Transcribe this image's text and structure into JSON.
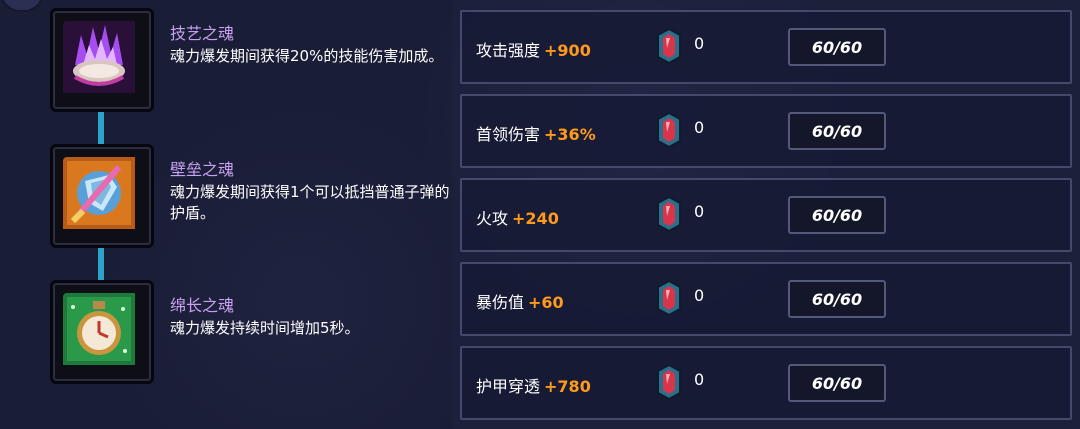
{
  "skills": [
    {
      "name": "技艺之魂",
      "description": "魂力爆发期间获得20%的技能伤害加成。",
      "icon": "purple-flame-shell-icon"
    },
    {
      "name": "壁垒之魂",
      "description": "魂力爆发期间获得1个可以抵挡普通子弹的护盾。",
      "icon": "shield-sword-icon"
    },
    {
      "name": "绵长之魂",
      "description": "魂力爆发持续时间增加5秒。",
      "icon": "stopwatch-icon"
    }
  ],
  "stats": [
    {
      "label": "攻击强度",
      "bonus": "+900",
      "gem_count": "0",
      "level": "60/60"
    },
    {
      "label": "首领伤害",
      "bonus": "+36%",
      "gem_count": "0",
      "level": "60/60"
    },
    {
      "label": "火攻",
      "bonus": "+240",
      "gem_count": "0",
      "level": "60/60"
    },
    {
      "label": "暴伤值",
      "bonus": "+60",
      "gem_count": "0",
      "level": "60/60"
    },
    {
      "label": "护甲穿透",
      "bonus": "+780",
      "gem_count": "0",
      "level": "60/60"
    }
  ],
  "colors": {
    "background": "#1a1d36",
    "skill_name": "#c8a2f0",
    "bonus": "#ff9a1c",
    "connector": "#2da3c8"
  }
}
